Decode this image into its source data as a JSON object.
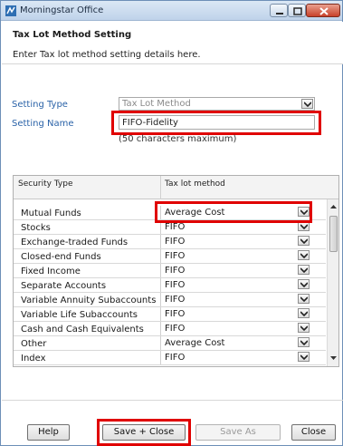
{
  "window": {
    "title": "Morningstar Office"
  },
  "header": {
    "title": "Tax Lot Method Setting",
    "description": "Enter Tax lot method setting details here."
  },
  "form": {
    "setting_type_label": "Setting Type",
    "setting_type_value": "Tax Lot Method",
    "setting_name_label": "Setting Name",
    "setting_name_value": "FIFO-Fidelity",
    "setting_name_hint": "(50 characters maximum)"
  },
  "grid": {
    "columns": [
      "Security Type",
      "Tax lot method"
    ],
    "rows": [
      {
        "security_type": "Mutual Funds",
        "method": "Average Cost"
      },
      {
        "security_type": "Stocks",
        "method": "FIFO"
      },
      {
        "security_type": "Exchange-traded Funds",
        "method": "FIFO"
      },
      {
        "security_type": "Closed-end Funds",
        "method": "FIFO"
      },
      {
        "security_type": "Fixed Income",
        "method": "FIFO"
      },
      {
        "security_type": "Separate Accounts",
        "method": "FIFO"
      },
      {
        "security_type": "Variable Annuity Subaccounts",
        "method": "FIFO"
      },
      {
        "security_type": "Variable Life Subaccounts",
        "method": "FIFO"
      },
      {
        "security_type": "Cash and Cash Equivalents",
        "method": "FIFO"
      },
      {
        "security_type": "Other",
        "method": "Average Cost"
      },
      {
        "security_type": "Index",
        "method": "FIFO"
      }
    ]
  },
  "buttons": {
    "help": "Help",
    "save_close": "Save + Close",
    "save_as": "Save As",
    "close": "Close"
  },
  "colors": {
    "highlight": "#e00000",
    "label_blue": "#2b63a8"
  }
}
